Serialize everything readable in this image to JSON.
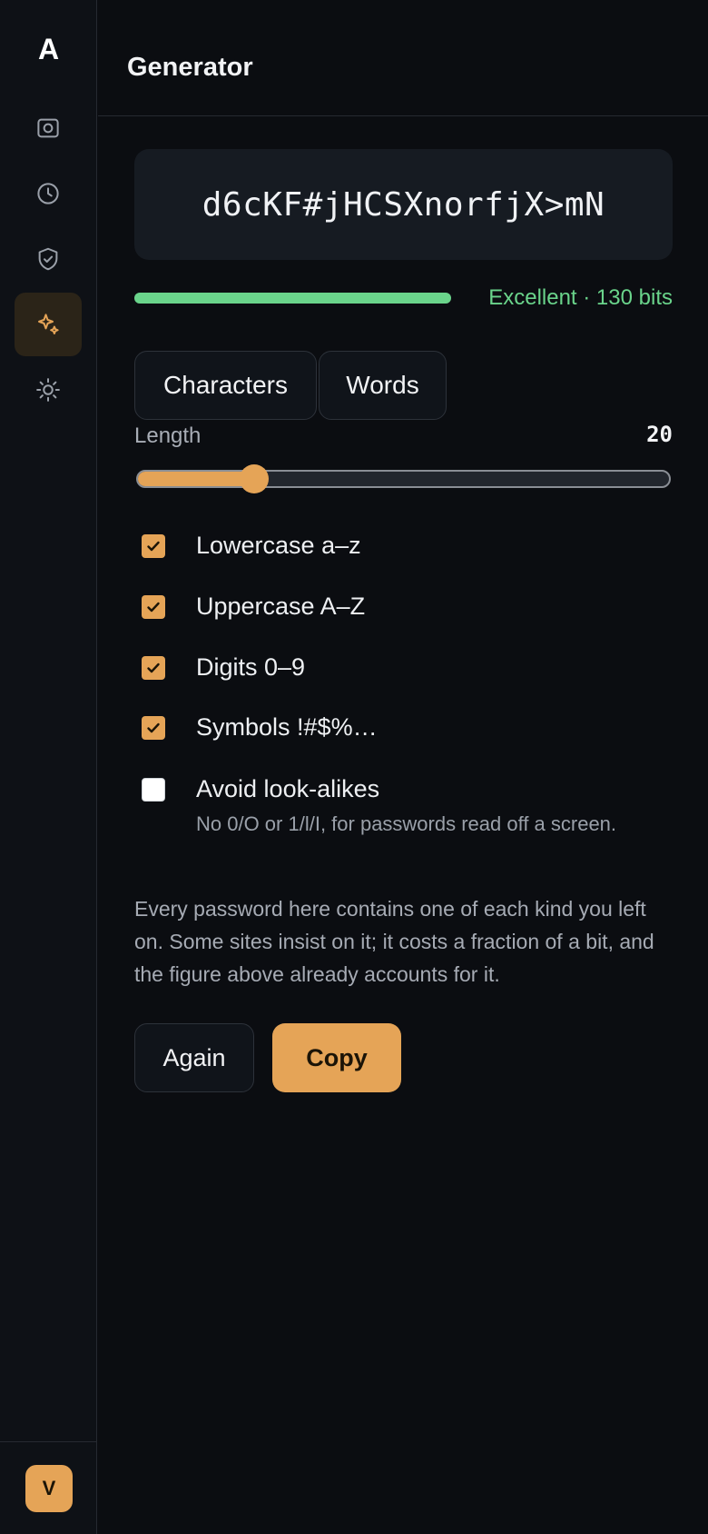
{
  "app": {
    "logo": "A",
    "user_initial": "V"
  },
  "header": {
    "title": "Generator"
  },
  "sidebar": {
    "items": [
      {
        "name": "vault",
        "icon": "safe-icon",
        "active": false
      },
      {
        "name": "history",
        "icon": "clock-icon",
        "active": false
      },
      {
        "name": "security",
        "icon": "shield-check-icon",
        "active": false
      },
      {
        "name": "generator",
        "icon": "sparkle-icon",
        "active": true
      },
      {
        "name": "appearance",
        "icon": "sun-icon",
        "active": false
      }
    ]
  },
  "generator": {
    "password": "d6cKF#jHCSXnorfjX>mN",
    "strength": {
      "label": "Excellent · 130 bits",
      "fraction": 1.0
    },
    "tabs": [
      {
        "label": "Characters"
      },
      {
        "label": "Words"
      }
    ],
    "length": {
      "label": "Length",
      "value": "20",
      "fraction": 0.22
    },
    "options": [
      {
        "label": "Lowercase a–z",
        "checked": true
      },
      {
        "label": "Uppercase A–Z",
        "checked": true
      },
      {
        "label": "Digits 0–9",
        "checked": true
      },
      {
        "label": "Symbols !#$%…",
        "checked": true
      },
      {
        "label": "Avoid look-alikes",
        "checked": false,
        "hint": "No 0/O or 1/l/I, for passwords read off a screen."
      }
    ],
    "note": "Every password here contains one of each kind you left on. Some sites insist on it; it costs a fraction of a bit, and the figure above already accounts for it.",
    "buttons": {
      "again": "Again",
      "copy": "Copy"
    }
  },
  "colors": {
    "accent": "#e5a457",
    "strength": "#6ad48b",
    "background": "#0b0d11",
    "surface": "#161b22"
  }
}
